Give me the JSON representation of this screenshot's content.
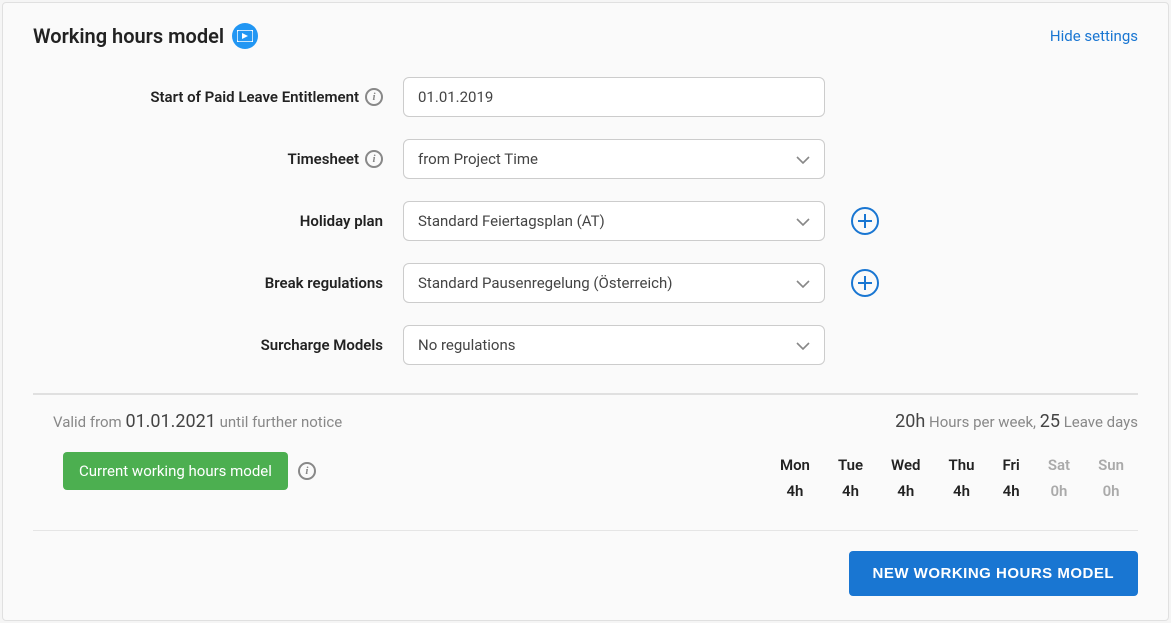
{
  "header": {
    "title": "Working hours model",
    "hide_link": "Hide settings"
  },
  "form": {
    "paid_leave": {
      "label": "Start of Paid Leave Entitlement",
      "value": "01.01.2019"
    },
    "timesheet": {
      "label": "Timesheet",
      "value": "from Project Time"
    },
    "holiday_plan": {
      "label": "Holiday plan",
      "value": "Standard Feiertagsplan (AT)"
    },
    "break_regulations": {
      "label": "Break regulations",
      "value": "Standard Pausenregelung (Österreich)"
    },
    "surcharge": {
      "label": "Surcharge Models",
      "value": "No regulations"
    }
  },
  "status": {
    "valid_from_label": "Valid from",
    "valid_from_date": "01.01.2021",
    "valid_until": "until further notice",
    "hours_value": "20h",
    "hours_label": "Hours per week,",
    "leave_value": "25",
    "leave_label": "Leave days"
  },
  "current_badge": "Current working hours model",
  "week": {
    "days": [
      "Mon",
      "Tue",
      "Wed",
      "Thu",
      "Fri",
      "Sat",
      "Sun"
    ],
    "hours": [
      "4h",
      "4h",
      "4h",
      "4h",
      "4h",
      "0h",
      "0h"
    ]
  },
  "footer": {
    "new_button": "NEW WORKING HOURS MODEL"
  }
}
